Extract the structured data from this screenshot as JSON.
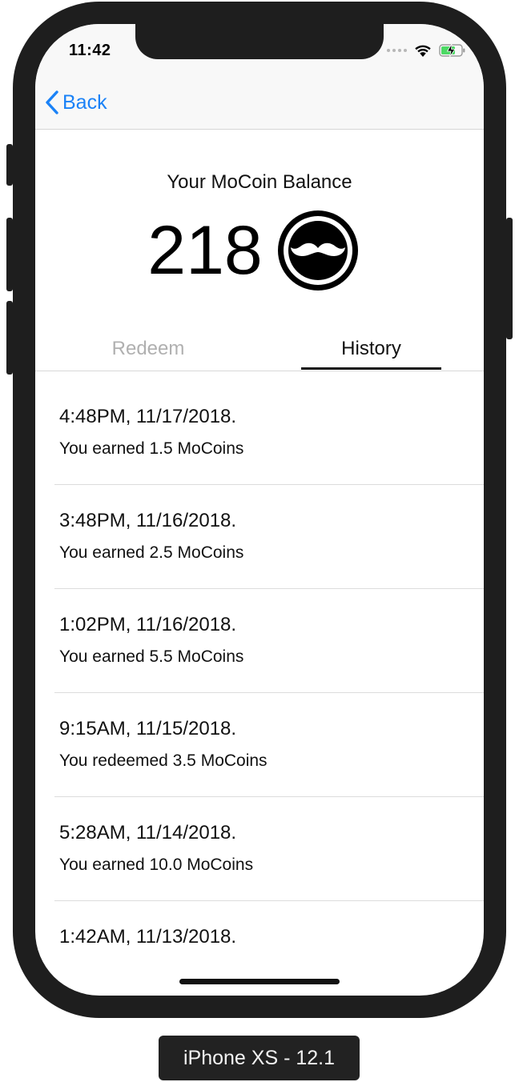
{
  "status_bar": {
    "time": "11:42",
    "icons": [
      "signal-dots-icon",
      "wifi-icon",
      "battery-charging-icon"
    ]
  },
  "nav": {
    "back_label": "Back",
    "back_icon": "chevron-left-icon"
  },
  "balance": {
    "title": "Your MoCoin Balance",
    "value": "218",
    "coin_icon": "mustache-coin-icon"
  },
  "tabs": [
    {
      "label": "Redeem",
      "active": false
    },
    {
      "label": "History",
      "active": true
    }
  ],
  "history": [
    {
      "when": "4:48PM, 11/17/2018.",
      "what": "You earned 1.5 MoCoins"
    },
    {
      "when": "3:48PM, 11/16/2018.",
      "what": "You earned 2.5 MoCoins"
    },
    {
      "when": "1:02PM, 11/16/2018.",
      "what": "You earned 5.5 MoCoins"
    },
    {
      "when": "9:15AM, 11/15/2018.",
      "what": "You redeemed 3.5 MoCoins"
    },
    {
      "when": "5:28AM, 11/14/2018.",
      "what": "You earned 10.0 MoCoins"
    },
    {
      "when": "1:42AM, 11/13/2018.",
      "what": ""
    }
  ],
  "device_label": "iPhone XS - 12.1",
  "colors": {
    "accent": "#1a82f7",
    "battery": "#4cd964",
    "frame": "#1e1e1e"
  }
}
